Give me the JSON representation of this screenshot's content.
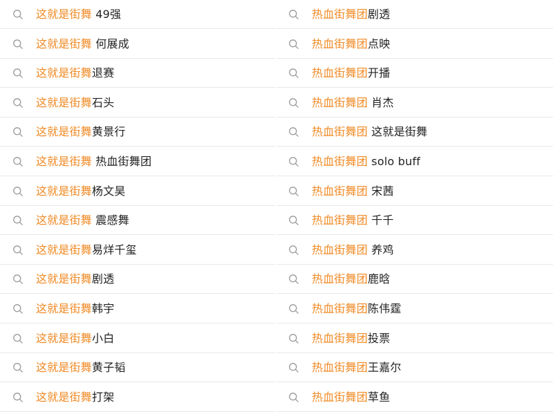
{
  "colors": {
    "keyword": "#f08a24",
    "text": "#222222",
    "icon": "#9a9a9a",
    "divider": "#e8e8e8"
  },
  "icon": "search-icon",
  "left_column": {
    "keyword": "这就是街舞",
    "items": [
      {
        "keyword": "这就是街舞",
        "suffix": " 49强"
      },
      {
        "keyword": "这就是街舞",
        "suffix": " 何展成"
      },
      {
        "keyword": "这就是街舞",
        "suffix": "退赛"
      },
      {
        "keyword": "这就是街舞",
        "suffix": "石头"
      },
      {
        "keyword": "这就是街舞",
        "suffix": "黄景行"
      },
      {
        "keyword": "这就是街舞",
        "suffix": " 热血街舞团"
      },
      {
        "keyword": "这就是街舞",
        "suffix": "杨文昊"
      },
      {
        "keyword": "这就是街舞",
        "suffix": " 震感舞"
      },
      {
        "keyword": "这就是街舞",
        "suffix": "易烊千玺"
      },
      {
        "keyword": "这就是街舞",
        "suffix": "剧透"
      },
      {
        "keyword": "这就是街舞",
        "suffix": "韩宇"
      },
      {
        "keyword": "这就是街舞",
        "suffix": "小白"
      },
      {
        "keyword": "这就是街舞",
        "suffix": "黄子韬"
      },
      {
        "keyword": "这就是街舞",
        "suffix": "打架"
      }
    ]
  },
  "right_column": {
    "keyword": "热血街舞团",
    "items": [
      {
        "keyword": "热血街舞团",
        "suffix": "剧透"
      },
      {
        "keyword": "热血街舞团",
        "suffix": "点映"
      },
      {
        "keyword": "热血街舞团",
        "suffix": "开播"
      },
      {
        "keyword": "热血街舞团",
        "suffix": " 肖杰"
      },
      {
        "keyword": "热血街舞团",
        "suffix": " 这就是街舞"
      },
      {
        "keyword": "热血街舞团",
        "suffix": " solo buff"
      },
      {
        "keyword": "热血街舞团",
        "suffix": " 宋茜"
      },
      {
        "keyword": "热血街舞团",
        "suffix": " 千千"
      },
      {
        "keyword": "热血街舞团",
        "suffix": " 养鸡"
      },
      {
        "keyword": "热血街舞团",
        "suffix": "鹿晗"
      },
      {
        "keyword": "热血街舞团",
        "suffix": "陈伟霆"
      },
      {
        "keyword": "热血街舞团",
        "suffix": "投票"
      },
      {
        "keyword": "热血街舞团",
        "suffix": "王嘉尔"
      },
      {
        "keyword": "热血街舞团",
        "suffix": "草鱼"
      }
    ]
  }
}
